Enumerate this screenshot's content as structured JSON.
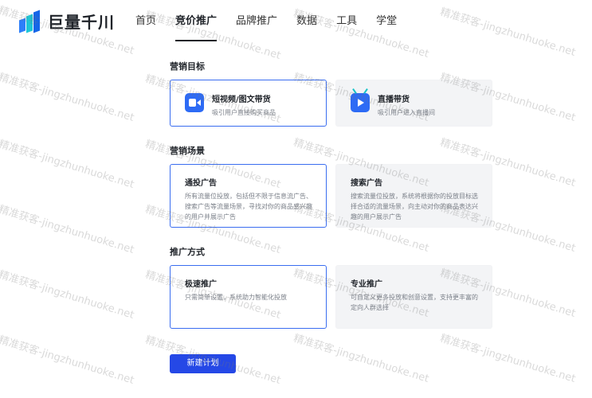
{
  "header": {
    "logo_text": "巨量千川",
    "nav": [
      {
        "label": "首页"
      },
      {
        "label": "竞价推广",
        "active": true
      },
      {
        "label": "品牌推广"
      },
      {
        "label": "数据"
      },
      {
        "label": "工具"
      },
      {
        "label": "学堂"
      }
    ]
  },
  "sections": {
    "goal": {
      "title": "营销目标",
      "cards": [
        {
          "title": "短视频/图文带货",
          "desc": "吸引用户直接购买商品",
          "icon": "video-camera-icon",
          "selected": true
        },
        {
          "title": "直播带货",
          "desc": "吸引用户进入直播间",
          "icon": "live-tv-icon",
          "selected": false
        }
      ]
    },
    "scene": {
      "title": "营销场景",
      "cards": [
        {
          "title": "通投广告",
          "desc": "所有流量位投放，包括但不限于信息流广告、搜索广告等流量场景，寻找对你的商品感兴趣的用户并展示广告",
          "selected": true
        },
        {
          "title": "搜索广告",
          "desc": "搜索流量位投放，系统将根据你的投放目标选择合适的流量场景，向主动对你的商品表达兴趣的用户展示广告",
          "selected": false
        }
      ]
    },
    "method": {
      "title": "推广方式",
      "cards": [
        {
          "title": "极速推广",
          "desc": "只需简单设置，系统助力智能化投放",
          "selected": true
        },
        {
          "title": "专业推广",
          "desc": "可自定义更多投放和创意设置，支持更丰富的定向人群选择",
          "selected": false
        }
      ]
    }
  },
  "actions": {
    "create_label": "新建计划"
  },
  "watermark": {
    "text": "精准获客-jingzhunhuoke.net"
  },
  "colors": {
    "accent": "#3a6df0",
    "button": "#2548e6",
    "card_unselected": "#f3f4f6"
  }
}
